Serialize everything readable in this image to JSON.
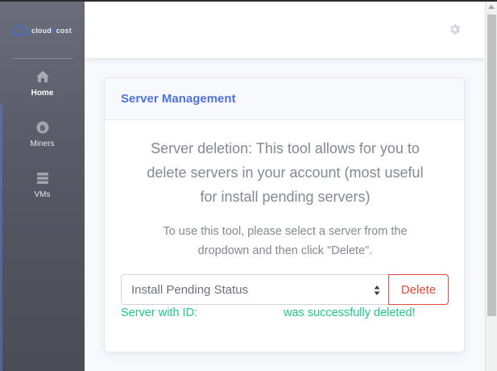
{
  "logo": {
    "text_part1": "cloud",
    "text_part2": "cost"
  },
  "sidebar": {
    "items": [
      {
        "label": "Home",
        "icon": "home-icon"
      },
      {
        "label": "Miners",
        "icon": "bitcoin-icon"
      },
      {
        "label": "VMs",
        "icon": "server-icon"
      }
    ]
  },
  "topbar": {
    "settings_icon": "gear-icon"
  },
  "card": {
    "title": "Server Management",
    "lead_line1": "Server deletion: This tool allows for you to",
    "lead_line2": "delete servers in your account (most useful",
    "lead_line3": "for install pending servers)",
    "instr_line1": "To use this tool, please select a server from the",
    "instr_line2": "dropdown and then click \"Delete\".",
    "select_value": "Install Pending Status",
    "delete_label": "Delete",
    "success_prefix": "Server with ID:",
    "success_suffix": "was successfully deleted!"
  },
  "colors": {
    "accent": "#4e73df",
    "danger": "#e74a3b",
    "success": "#1cc88a",
    "muted_text": "#858796"
  }
}
